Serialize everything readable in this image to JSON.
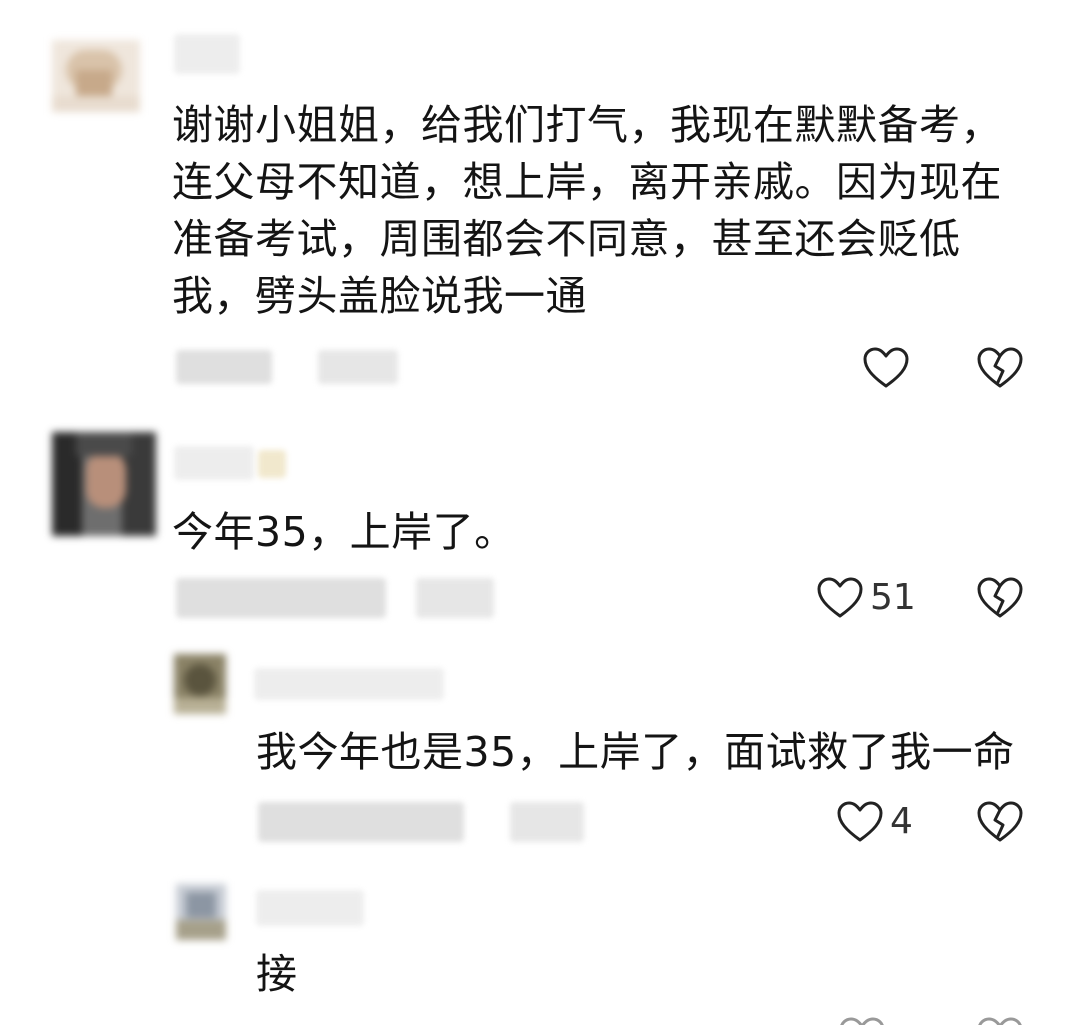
{
  "comments": [
    {
      "text": "谢谢小姐姐，给我们打气，我现在默默备考，\n连父母不知道，想上岸，离开亲戚。因为现在\n准备考试，周围都会不同意，甚至还会贬低\n我，劈头盖脸说我一通",
      "like_count": "",
      "like_icon": "heart-outline-icon",
      "dislike_icon": "broken-heart-icon"
    },
    {
      "text": "今年35，上岸了。",
      "like_count": "51",
      "like_icon": "heart-outline-icon",
      "dislike_icon": "broken-heart-icon",
      "replies": [
        {
          "text": "我今年也是35，上岸了，面试救了我一命",
          "like_count": "4",
          "like_icon": "heart-outline-icon",
          "dislike_icon": "broken-heart-icon"
        },
        {
          "text": "接"
        }
      ]
    }
  ],
  "colors": {
    "text": "#141414",
    "icon": "#222222",
    "background": "#ffffff"
  }
}
